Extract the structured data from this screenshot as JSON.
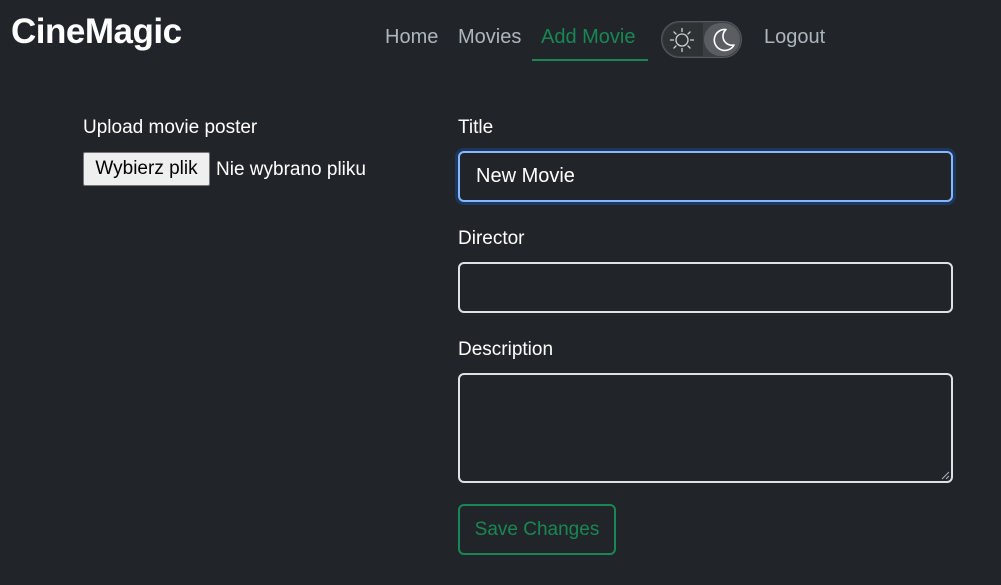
{
  "navbar": {
    "brand": "CineMagic",
    "links": {
      "home": "Home",
      "movies": "Movies",
      "add_movie": "Add Movie",
      "logout": "Logout"
    },
    "active_link": "add_movie",
    "theme_toggle": {
      "light_icon": "sun-icon",
      "dark_icon": "moon-icon",
      "mode": "dark"
    }
  },
  "upload": {
    "label": "Upload movie poster",
    "button_label": "Wybierz plik",
    "status": "Nie wybrano pliku"
  },
  "form": {
    "title": {
      "label": "Title",
      "value": "New Movie",
      "focused": true
    },
    "director": {
      "label": "Director",
      "value": ""
    },
    "description": {
      "label": "Description",
      "value": ""
    },
    "save_label": "Save Changes"
  },
  "colors": {
    "background": "#212529",
    "accent": "#198754",
    "focus_border": "#86b7fe",
    "nav_link": "#adb5bd"
  }
}
